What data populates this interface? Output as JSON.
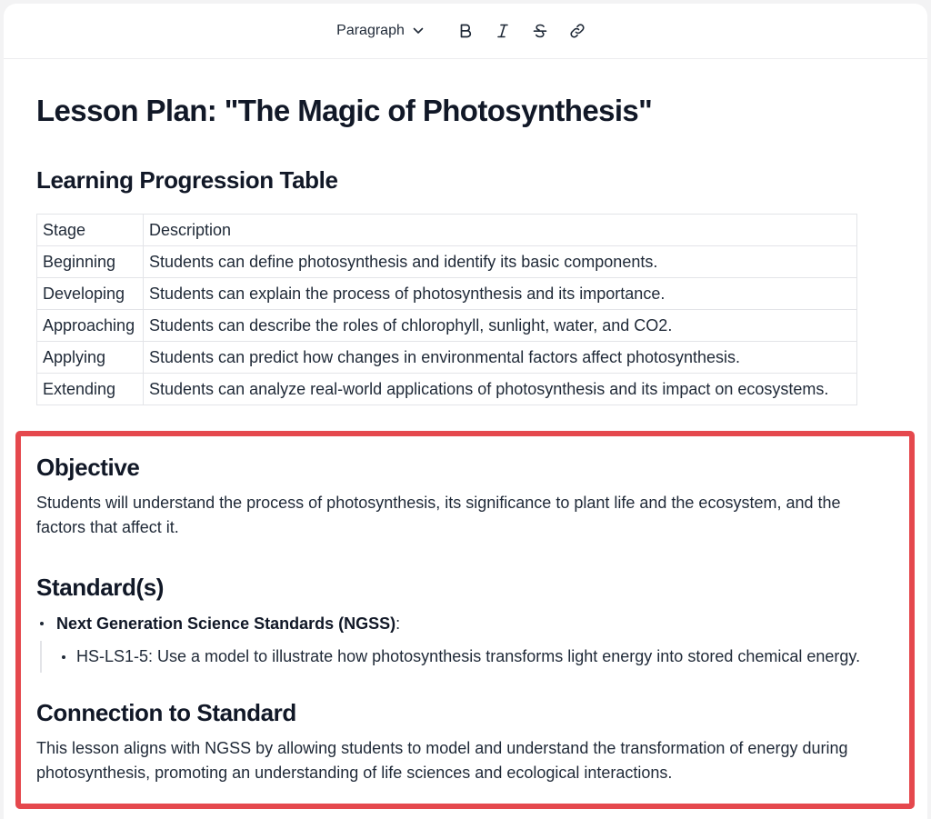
{
  "toolbar": {
    "block_type": "Paragraph",
    "icons": [
      "chevron-down-icon",
      "bold-icon",
      "italic-icon",
      "strikethrough-icon",
      "link-icon"
    ]
  },
  "document": {
    "title": "Lesson Plan: \"The Magic of Photosynthesis\"",
    "table_heading": "Learning Progression Table",
    "table": {
      "headers": [
        "Stage",
        "Description"
      ],
      "rows": [
        [
          "Beginning",
          "Students can define photosynthesis and identify its basic components."
        ],
        [
          "Developing",
          "Students can explain the process of photosynthesis and its importance."
        ],
        [
          "Approaching",
          "Students can describe the roles of chlorophyll, sunlight, water, and CO2."
        ],
        [
          "Applying",
          "Students can predict how changes in environmental factors affect photosynthesis."
        ],
        [
          "Extending",
          "Students can analyze real-world applications of photosynthesis and its impact on ecosystems."
        ]
      ]
    },
    "objective": {
      "heading": "Objective",
      "text": "Students will understand the process of photosynthesis, its significance to plant life and the ecosystem, and the factors that affect it."
    },
    "standards": {
      "heading": "Standard(s)",
      "item_bold": "Next Generation Science Standards (NGSS)",
      "item_suffix": ":",
      "sub_item": "HS-LS1-5: Use a model to illustrate how photosynthesis transforms light energy into stored chemical energy."
    },
    "connection": {
      "heading": "Connection to Standard",
      "text": "This lesson aligns with NGSS by allowing students to model and understand the transformation of energy during photosynthesis, promoting an understanding of life sciences and ecological interactions."
    }
  },
  "colors": {
    "highlight_border": "#e5484d",
    "text": "#111827",
    "table_border": "#e3e4e8"
  }
}
